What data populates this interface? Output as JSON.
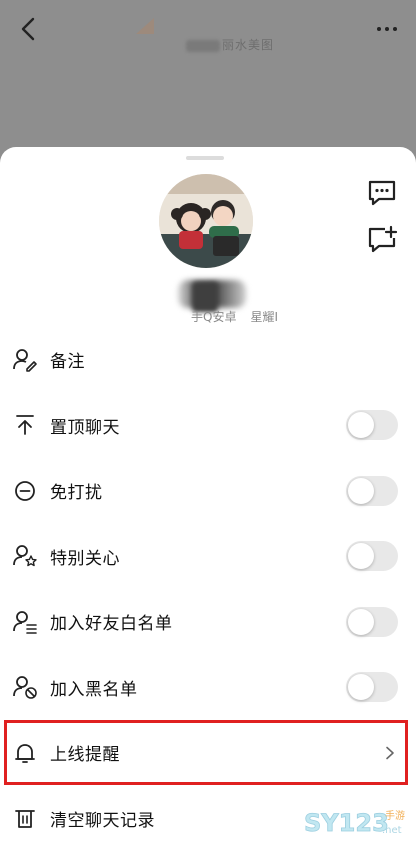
{
  "background": {
    "title": "丽水美图"
  },
  "profile": {
    "tags": [
      "手Q安卓",
      "星耀I"
    ]
  },
  "settings": [
    {
      "label": "备注",
      "control": "none"
    },
    {
      "label": "置顶聊天",
      "control": "toggle",
      "on": false
    },
    {
      "label": "免打扰",
      "control": "toggle",
      "on": false
    },
    {
      "label": "特别关心",
      "control": "toggle",
      "on": false
    },
    {
      "label": "加入好友白名单",
      "control": "toggle",
      "on": false
    },
    {
      "label": "加入黑名单",
      "control": "toggle",
      "on": false
    },
    {
      "label": "上线提醒",
      "control": "chevron",
      "highlighted": true
    },
    {
      "label": "清空聊天记录",
      "control": "none"
    }
  ],
  "watermark": {
    "text": "SY123",
    "sub": "手游",
    "suffix": ".net"
  },
  "colors": {
    "highlight": "#e02020",
    "toggle_off": "#e8e8e8"
  }
}
